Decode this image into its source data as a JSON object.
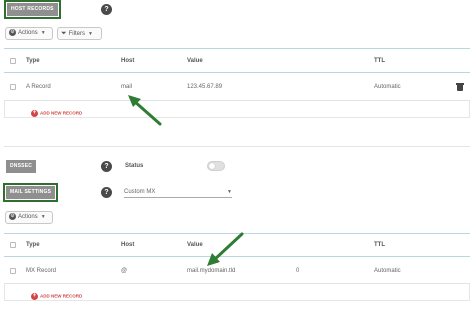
{
  "host_records": {
    "section_label": "HOST RECORDS",
    "help_icon": "?",
    "actions_label": "Actions",
    "filters_label": "Filters",
    "columns": [
      "Type",
      "Host",
      "Value",
      "TTL"
    ],
    "rows": [
      {
        "type": "A Record",
        "host": "mail",
        "value": "123.45.67.89",
        "ttl": "Automatic"
      }
    ],
    "add_label": "ADD NEW RECORD"
  },
  "dnssec": {
    "section_label": "DNSSEC",
    "help_icon": "?",
    "status_label": "Status"
  },
  "mail_settings": {
    "section_label": "MAIL SETTINGS",
    "help_icon": "?",
    "selected_option": "Custom MX",
    "actions_label": "Actions",
    "columns": [
      "Type",
      "Host",
      "Value",
      "TTL"
    ],
    "rows": [
      {
        "type": "MX Record",
        "host": "@",
        "value": "mail.mydomain.tld",
        "priority": "0",
        "ttl": "Automatic"
      }
    ],
    "add_label": "ADD NEW RECORD"
  },
  "annotations": {
    "arrow_color": "#2e7d32"
  },
  "icons": [
    "help-icon",
    "gear-icon",
    "filter-icon",
    "caret-down-icon",
    "trash-icon",
    "plus-icon",
    "arrow-icon"
  ]
}
